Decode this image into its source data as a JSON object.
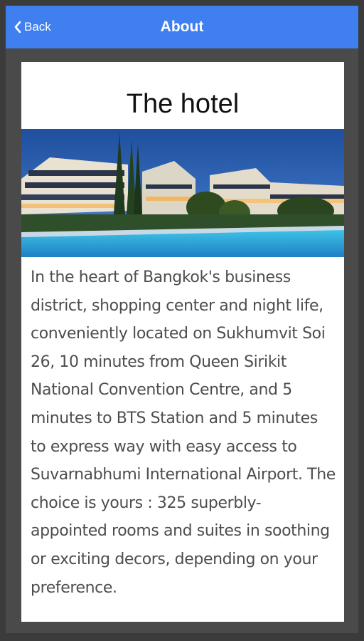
{
  "header": {
    "back_label": "Back",
    "title": "About"
  },
  "card": {
    "heading": "The hotel",
    "description": "In the heart of Bangkok's business district, shopping center and night life, conveniently located on Sukhumvit Soi 26, 10 minutes from Queen Sirikit National Convention Centre, and 5 minutes to BTS Station and 5 minutes to express way with easy access to Suvarnabhumi International Airport. The choice is yours : 325 superbly-appointed rooms and suites in soothing or exciting decors, depending on your preference."
  },
  "colors": {
    "header_bg": "#3f7ff0",
    "frame_bg": "#3b3b3b",
    "card_bg": "#ffffff",
    "text": "#4d4d4d"
  },
  "icons": {
    "back": "chevron-left-icon"
  }
}
